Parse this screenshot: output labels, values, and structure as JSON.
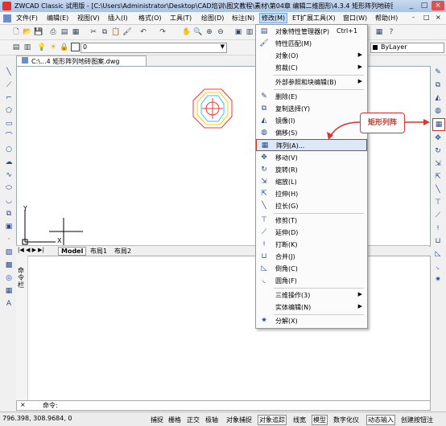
{
  "window": {
    "title": "ZWCAD Classic 试用版 - [C:\\Users\\Administrator\\Desktop\\CAD培训\\图文教程\\素材\\第04章 编辑二维图形\\4.3.4  矩形阵列地砖图案.dwg]",
    "min": "_",
    "max": "□",
    "close": "×"
  },
  "menubar": {
    "items": [
      {
        "label": "文件(F)"
      },
      {
        "label": "编辑(E)"
      },
      {
        "label": "视图(V)"
      },
      {
        "label": "插入(I)"
      },
      {
        "label": "格式(O)"
      },
      {
        "label": "工具(T)"
      },
      {
        "label": "绘图(D)"
      },
      {
        "label": "标注(N)"
      },
      {
        "label": "修改(M)"
      },
      {
        "label": "ET扩展工具(X)"
      },
      {
        "label": "窗口(W)"
      },
      {
        "label": "帮助(H)"
      }
    ],
    "doc_min": "-",
    "doc_max": "□",
    "doc_close": "×"
  },
  "toolbar": {
    "layer_value": "0",
    "linetype_value": "ByLayer"
  },
  "document": {
    "tab_label": "C:\\...4  矩形阵列地砖图案.dwg"
  },
  "layout_tabs": {
    "model": "Model",
    "layout1": "布局1",
    "layout2": "布局2"
  },
  "ucs": {
    "y": "Y",
    "x": "X"
  },
  "command": {
    "side_label": "命令栏",
    "prompt": "命令:"
  },
  "statusbar": {
    "coords": "796.398,  308.9684,  0",
    "buttons": [
      {
        "label": "捕捉",
        "on": false
      },
      {
        "label": "栅格",
        "on": false
      },
      {
        "label": "正交",
        "on": false
      },
      {
        "label": "极轴",
        "on": false
      },
      {
        "label": "对象捕捉",
        "on": false
      },
      {
        "label": "对象追踪",
        "on": true
      },
      {
        "label": "线宽",
        "on": false
      },
      {
        "label": "模型",
        "on": true
      },
      {
        "label": "数字化仪",
        "on": false
      },
      {
        "label": "动态输入",
        "on": true
      },
      {
        "label": "创建按钮注",
        "on": false
      }
    ]
  },
  "modify_menu": {
    "items": [
      {
        "label": "对象特性管理器(P)",
        "shortcut": "Ctrl+1",
        "icon": "properties-icon"
      },
      {
        "label": "特性匹配(M)",
        "icon": "match-properties-icon"
      },
      {
        "label": "对象(O)",
        "arrow": "▶"
      },
      {
        "label": "剪裁(C)",
        "arrow": "▶"
      },
      {
        "label": "外部参照和块编辑(B)",
        "arrow": "▶"
      },
      {
        "label": "删除(E)",
        "icon": "erase-icon"
      },
      {
        "label": "复制选择(Y)",
        "icon": "copy-icon"
      },
      {
        "label": "镜像(I)",
        "icon": "mirror-icon"
      },
      {
        "label": "偏移(S)",
        "icon": "offset-icon"
      },
      {
        "label": "阵列(A)...",
        "icon": "array-icon",
        "highlighted": true
      },
      {
        "label": "移动(V)",
        "icon": "move-icon"
      },
      {
        "label": "旋转(R)",
        "icon": "rotate-icon"
      },
      {
        "label": "缩放(L)",
        "icon": "scale-icon"
      },
      {
        "label": "拉伸(H)",
        "icon": "stretch-icon"
      },
      {
        "label": "拉长(G)",
        "icon": "lengthen-icon"
      },
      {
        "label": "修剪(T)",
        "icon": "trim-icon"
      },
      {
        "label": "延伸(D)",
        "icon": "extend-icon"
      },
      {
        "label": "打断(K)",
        "icon": "break-icon"
      },
      {
        "label": "合并(J)",
        "icon": "join-icon"
      },
      {
        "label": "倒角(C)",
        "icon": "chamfer-icon"
      },
      {
        "label": "圆角(F)",
        "icon": "fillet-icon"
      },
      {
        "label": "三维操作(3)",
        "arrow": "▶"
      },
      {
        "label": "实体编辑(N)",
        "arrow": "▶"
      },
      {
        "label": "分解(X)",
        "icon": "explode-icon"
      }
    ]
  },
  "callout": {
    "text": "矩形列阵"
  },
  "colors": {
    "highlight_border": "#c0392b",
    "accent": "#2a4a8a"
  }
}
